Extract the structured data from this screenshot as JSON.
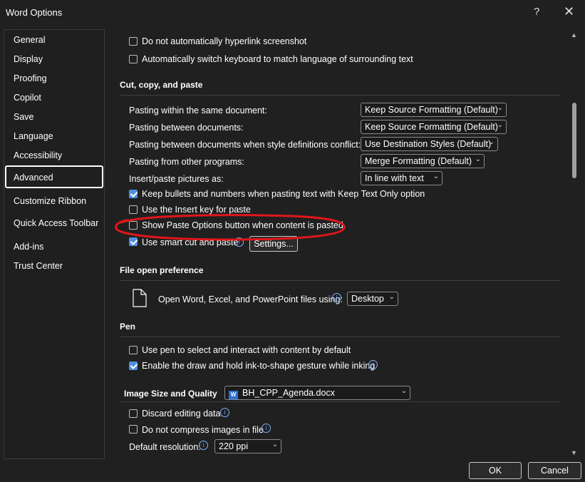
{
  "window": {
    "title": "Word Options",
    "help_icon": "?",
    "close_icon": "✕"
  },
  "sidebar": {
    "items": [
      {
        "label": "General"
      },
      {
        "label": "Display"
      },
      {
        "label": "Proofing"
      },
      {
        "label": "Copilot"
      },
      {
        "label": "Save"
      },
      {
        "label": "Language"
      },
      {
        "label": "Accessibility"
      },
      {
        "label": "Advanced"
      },
      {
        "label": "Customize Ribbon"
      },
      {
        "label": "Quick Access Toolbar"
      },
      {
        "label": "Add-ins"
      },
      {
        "label": "Trust Center"
      }
    ],
    "selected": "Advanced"
  },
  "top_options": [
    {
      "label": "Do not automatically hyperlink screenshot",
      "checked": false
    },
    {
      "label": "Automatically switch keyboard to match language of surrounding text",
      "checked": false
    }
  ],
  "cut_copy_paste": {
    "heading": "Cut, copy, and paste",
    "rows": [
      {
        "label": "Pasting within the same document:",
        "value": "Keep Source Formatting (Default)"
      },
      {
        "label": "Pasting between documents:",
        "value": "Keep Source Formatting (Default)"
      },
      {
        "label": "Pasting between documents when style definitions conflict:",
        "value": "Use Destination Styles (Default)"
      },
      {
        "label": "Pasting from other programs:",
        "value": "Merge Formatting (Default)"
      },
      {
        "label": "Insert/paste pictures as:",
        "value": "In line with text"
      }
    ],
    "checks": [
      {
        "label": "Keep bullets and numbers when pasting text with Keep Text Only option",
        "checked": true
      },
      {
        "label": "Use the Insert key for paste",
        "checked": false
      },
      {
        "label": "Show Paste Options button when content is pasted",
        "checked": false
      },
      {
        "label": "Use smart cut and paste",
        "checked": true
      }
    ],
    "settings_button": "Settings...",
    "highlight_color": "#e0161b"
  },
  "file_open": {
    "heading": "File open preference",
    "label": "Open Word, Excel, and PowerPoint files using:",
    "value": "Desktop"
  },
  "pen": {
    "heading": "Pen",
    "checks": [
      {
        "label": "Use pen to select and interact with content by default",
        "checked": false
      },
      {
        "label": "Enable the draw and hold ink-to-shape gesture while inking",
        "checked": true
      }
    ]
  },
  "image_size": {
    "heading": "Image Size and Quality",
    "document": "BH_CPP_Agenda.docx",
    "checks": [
      {
        "label": "Discard editing data",
        "checked": false
      },
      {
        "label": "Do not compress images in file",
        "checked": false
      }
    ],
    "resolution_label": "Default resolution:",
    "resolution_value": "220 ppi"
  },
  "footer": {
    "ok": "OK",
    "cancel": "Cancel"
  },
  "colors": {
    "accent": "#4f8fe0",
    "background": "#202020",
    "info": "#7eb3ff"
  }
}
